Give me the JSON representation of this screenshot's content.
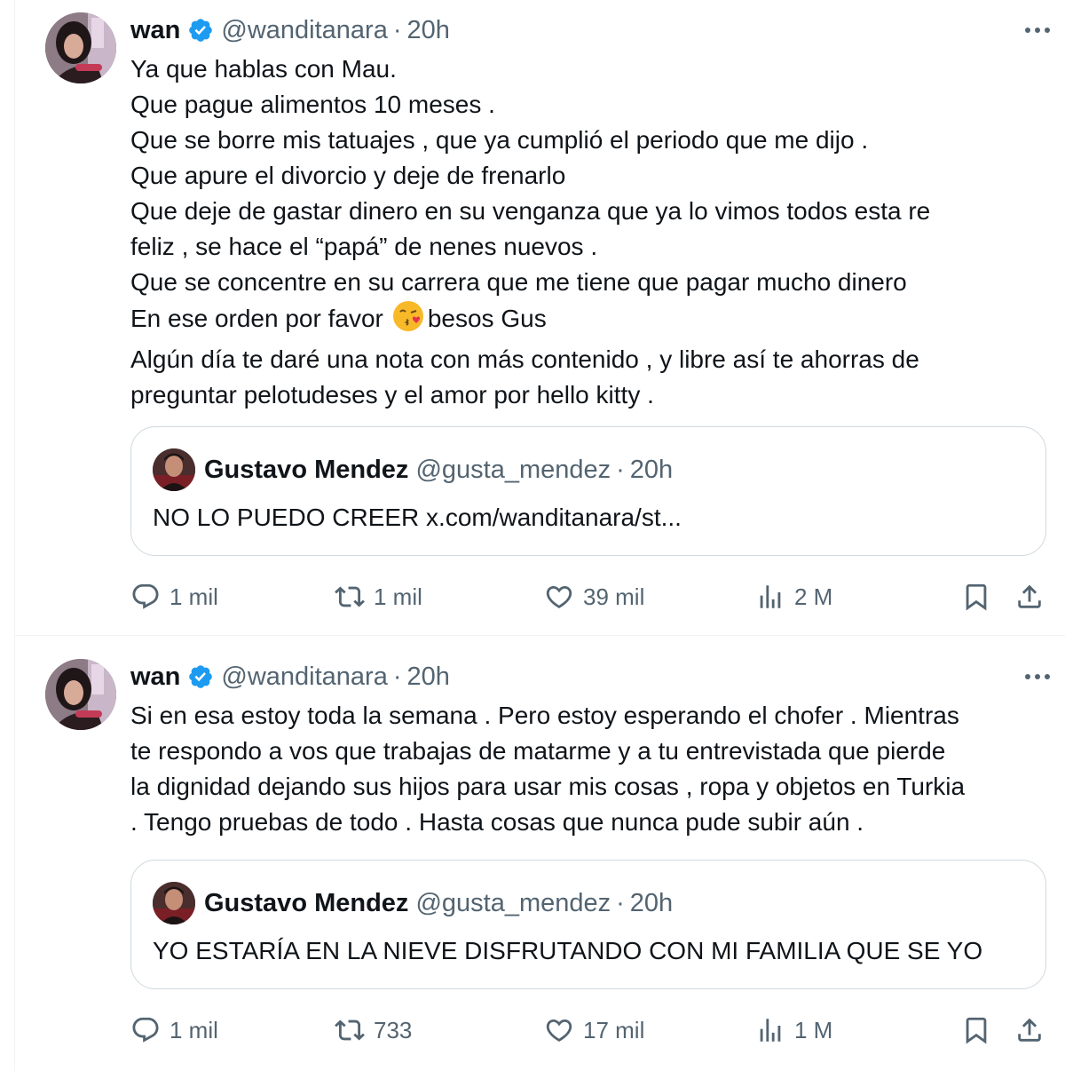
{
  "tweets": [
    {
      "author": {
        "name": "wan",
        "handle": "@wanditanara",
        "time": "20h"
      },
      "lines": [
        "Ya que hablas con Mau.",
        "Que pague alimentos 10 meses .",
        "Que se borre mis tatuajes , que ya cumplió el periodo que me dijo .",
        "Que apure el divorcio y deje de frenarlo",
        "Que deje de gastar dinero en su venganza que ya lo vimos todos esta re",
        "feliz , se hace el “papá” de nenes nuevos .",
        "Que se concentre en su carrera que me tiene que pagar mucho dinero",
        "Algún día te daré una nota con más contenido , y libre así te ahorras de",
        "preguntar pelotudeses y el amor por hello kitty ."
      ],
      "emoji_line": {
        "before": "En ese orden por favor",
        "after": "besos Gus",
        "emoji": "kissing-face-emoji"
      },
      "quote": {
        "name": "Gustavo Mendez",
        "handle": "@gusta_mendez",
        "time": "20h",
        "text": "NO LO PUEDO CREER x.com/wanditanara/st..."
      },
      "stats": {
        "replies": "1 mil",
        "reposts": "1 mil",
        "likes": "39 mil",
        "views": "2 M"
      }
    },
    {
      "author": {
        "name": "wan",
        "handle": "@wanditanara",
        "time": "20h"
      },
      "lines": [
        "Si en esa estoy toda la semana . Pero estoy esperando el chofer . Mientras",
        "te respondo a vos que trabajas de matarme y a tu entrevistada que pierde",
        "la dignidad dejando sus hijos para usar mis cosas , ropa y objetos en Turkia",
        ".  Tengo pruebas de todo .  Hasta cosas que nunca pude subir aún ."
      ],
      "quote": {
        "name": "Gustavo Mendez",
        "handle": "@gusta_mendez",
        "time": "20h",
        "text": "YO ESTARÍA EN LA NIEVE DISFRUTANDO CON MI FAMILIA QUE SE YO"
      },
      "stats": {
        "replies": "1 mil",
        "reposts": "733",
        "likes": "17 mil",
        "views": "1 M"
      }
    }
  ],
  "separator": "·",
  "colors": {
    "verified": "#1d9bf0",
    "text": "#0f1419",
    "secondary": "#536471",
    "border": "#cfd9de"
  }
}
